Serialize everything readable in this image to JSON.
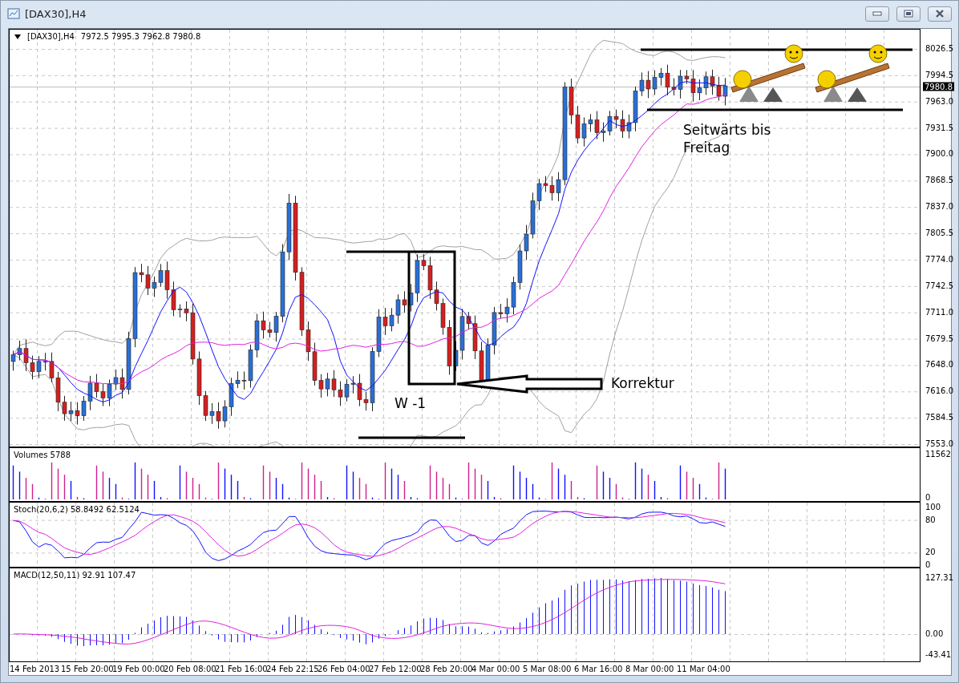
{
  "window": {
    "title": "[DAX30],H4"
  },
  "chart": {
    "symbol_label": "[DAX30],H4",
    "ohlc": "7972.5 7995.3 7962.8 7980.8",
    "current_price": "7980.8",
    "price_ticks": [
      "8026.5",
      "7994.5",
      "7963.0",
      "7931.5",
      "7900.0",
      "7868.5",
      "7837.0",
      "7805.5",
      "7774.0",
      "7742.5",
      "7711.0",
      "7679.5",
      "7648.0",
      "7616.0",
      "7584.5",
      "7553.0"
    ],
    "annotations": [
      {
        "kind": "wave",
        "text": "W -1"
      },
      {
        "kind": "arrow_note",
        "text": "Korrektur"
      },
      {
        "kind": "range_note",
        "text": "Seitwärts bis Freitag"
      }
    ]
  },
  "panels": [
    {
      "kind": "volume",
      "label": "Volumes 5788",
      "ticks": [
        "11562",
        "0"
      ]
    },
    {
      "kind": "stoch",
      "label": "Stoch(20,6,2) 58.8492 62.5124",
      "ticks": [
        "100",
        "80",
        "20",
        "0"
      ]
    },
    {
      "kind": "macd",
      "label": "MACD(12,50,11) 92.91 107.47",
      "ticks": [
        "127.31",
        "0.00",
        "-43.41"
      ]
    }
  ],
  "time_axis": [
    "14 Feb 2013",
    "15 Feb 20:00",
    "19 Feb 00:00",
    "20 Feb 08:00",
    "21 Feb 16:00",
    "24 Feb 22:15",
    "26 Feb 04:00",
    "27 Feb 12:00",
    "28 Feb 20:00",
    "4 Mar 00:00",
    "5 Mar 08:00",
    "6 Mar 16:00",
    "8 Mar 00:00",
    "11 Mar 04:00"
  ]
}
